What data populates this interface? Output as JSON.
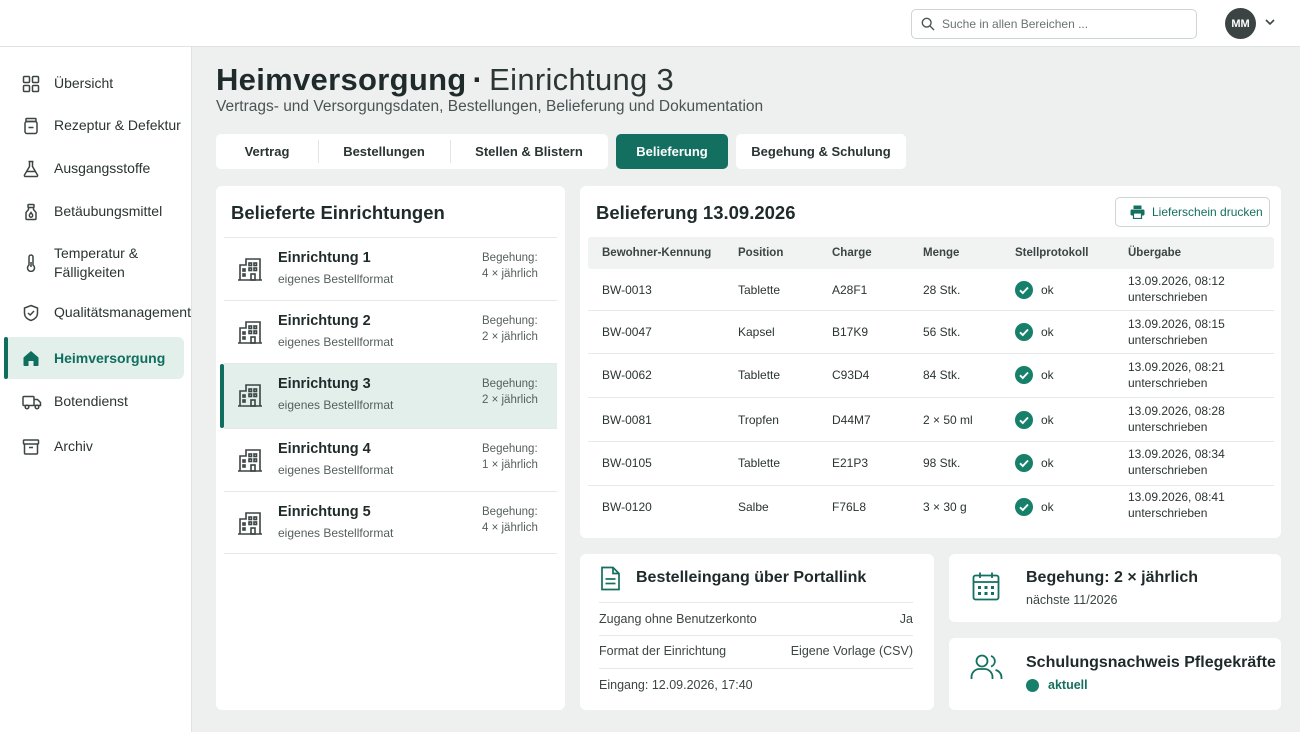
{
  "header": {
    "search_placeholder": "Suche in allen Bereichen ...",
    "user_initials": "MM"
  },
  "sidebar": {
    "items": [
      {
        "label": "Übersicht",
        "icon": "grid-icon"
      },
      {
        "label": "Rezeptur & Defektur",
        "icon": "jar-icon"
      },
      {
        "label": "Ausgangsstoffe",
        "icon": "flask-icon"
      },
      {
        "label": "Betäubungsmittel",
        "icon": "drop-icon"
      },
      {
        "label": "Temperatur & Fälligkeiten",
        "icon": "thermometer-icon"
      },
      {
        "label": "Qualitätsmanagement",
        "icon": "shield-check-icon"
      },
      {
        "label": "Heimversorgung",
        "icon": "home-icon",
        "active": true
      },
      {
        "label": "Botendienst",
        "icon": "truck-icon"
      },
      {
        "label": "Archiv",
        "icon": "archive-icon"
      }
    ]
  },
  "page": {
    "title": "Heimversorgung",
    "separator": "·",
    "facility": "Einrichtung 3",
    "subtitle": "Vertrags- und Versorgungsdaten, Bestellungen, Belieferung und Dokumentation"
  },
  "tabs": [
    {
      "label": "Vertrag"
    },
    {
      "label": "Bestellungen"
    },
    {
      "label": "Stellen & Blistern"
    },
    {
      "label": "Belieferung",
      "active": true
    },
    {
      "label": "Begehung & Schulung"
    }
  ],
  "facilities": {
    "title": "Belieferte Einrichtungen",
    "items": [
      {
        "name": "Einrichtung 1",
        "format": "eigenes Bestellformat",
        "visit_label": "Begehung:",
        "visit_freq": "4 × jährlich"
      },
      {
        "name": "Einrichtung 2",
        "format": "eigenes Bestellformat",
        "visit_label": "Begehung:",
        "visit_freq": "2 × jährlich"
      },
      {
        "name": "Einrichtung 3",
        "format": "eigenes Bestellformat",
        "visit_label": "Begehung:",
        "visit_freq": "2 × jährlich",
        "active": true
      },
      {
        "name": "Einrichtung 4",
        "format": "eigenes Bestellformat",
        "visit_label": "Begehung:",
        "visit_freq": "1 × jährlich"
      },
      {
        "name": "Einrichtung 5",
        "format": "eigenes Bestellformat",
        "visit_label": "Begehung:",
        "visit_freq": "4 × jährlich"
      }
    ]
  },
  "delivery": {
    "title": "Belieferung 13.09.2026",
    "print_label": "Lieferschein drucken",
    "columns": [
      "Bewohner-Kennung",
      "Position",
      "Charge",
      "Menge",
      "Stellprotokoll",
      "Übergabe"
    ],
    "rows": [
      {
        "id": "BW-0013",
        "position": "Tablette",
        "charge": "A28F1",
        "menge": "28 Stk.",
        "status": "ok",
        "time": "13.09.2026, 08:12",
        "state": "unterschrieben"
      },
      {
        "id": "BW-0047",
        "position": "Kapsel",
        "charge": "B17K9",
        "menge": "56 Stk.",
        "status": "ok",
        "time": "13.09.2026, 08:15",
        "state": "unterschrieben"
      },
      {
        "id": "BW-0062",
        "position": "Tablette",
        "charge": "C93D4",
        "menge": "84 Stk.",
        "status": "ok",
        "time": "13.09.2026, 08:21",
        "state": "unterschrieben"
      },
      {
        "id": "BW-0081",
        "position": "Tropfen",
        "charge": "D44M7",
        "menge": "2 × 50 ml",
        "status": "ok",
        "time": "13.09.2026, 08:28",
        "state": "unterschrieben"
      },
      {
        "id": "BW-0105",
        "position": "Tablette",
        "charge": "E21P3",
        "menge": "98 Stk.",
        "status": "ok",
        "time": "13.09.2026, 08:34",
        "state": "unterschrieben"
      },
      {
        "id": "BW-0120",
        "position": "Salbe",
        "charge": "F76L8",
        "menge": "3 × 30 g",
        "status": "ok",
        "time": "13.09.2026, 08:41",
        "state": "unterschrieben"
      }
    ]
  },
  "portal": {
    "title": "Bestelleingang über Portallink",
    "rows": [
      {
        "key": "Zugang ohne Benutzerkonto",
        "value": "Ja"
      },
      {
        "key": "Format der Einrichtung",
        "value": "Eigene Vorlage (CSV)"
      }
    ],
    "received": "Eingang: 12.09.2026, 17:40"
  },
  "visit": {
    "title": "Begehung: 2 × jährlich",
    "next": "nächste 11/2026"
  },
  "training": {
    "title": "Schulungsnachweis Pflegekräfte",
    "status": "aktuell"
  },
  "colors": {
    "accent": "#136f60",
    "status_ok": "#17806a"
  }
}
